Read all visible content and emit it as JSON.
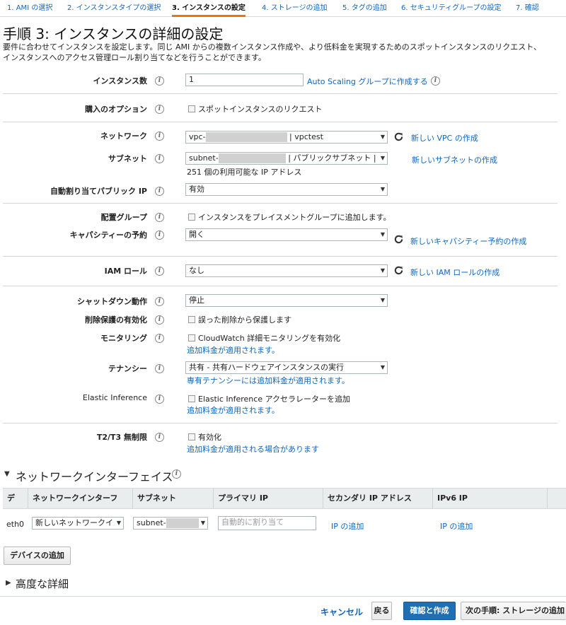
{
  "steps": [
    {
      "label": "1. AMI の選択"
    },
    {
      "label": "2. インスタンスタイプの選択"
    },
    {
      "label": "3. インスタンスの設定"
    },
    {
      "label": "4. ストレージの追加"
    },
    {
      "label": "5. タグの追加"
    },
    {
      "label": "6. セキュリティグループの設定"
    },
    {
      "label": "7. 確認"
    }
  ],
  "title": "手順 3: インスタンスの詳細の設定",
  "description_line1": "要件に合わせてインスタンスを設定します。同じ AMI からの複数インスタンス作成や、より低料金を実現するためのスポットインスタンスのリクエスト、",
  "description_line2": "インスタンスへのアクセス管理ロール割り当てなどを行うことができます。",
  "info_glyph": "i",
  "form": {
    "instance_count": {
      "label": "インスタンス数",
      "value": "1",
      "link": "Auto Scaling グループに作成する"
    },
    "purchase": {
      "label": "購入のオプション",
      "checkbox": "スポットインスタンスのリクエスト"
    },
    "network": {
      "label": "ネットワーク",
      "value_prefix": "vpc-",
      "value_suffix": "| vpctest",
      "link": "新しい VPC の作成"
    },
    "subnet": {
      "label": "サブネット",
      "value_prefix": "subnet-",
      "value_suffix": "| パブリックサブネット |",
      "link": "新しいサブネットの作成",
      "note": "251 個の利用可能な IP アドレス"
    },
    "auto_ip": {
      "label": "自動割り当てパブリック IP",
      "value": "有効"
    },
    "placement": {
      "label": "配置グループ",
      "checkbox": "インスタンスをプレイスメントグループに追加します。"
    },
    "capacity": {
      "label": "キャパシティーの予約",
      "value": "開く",
      "link": "新しいキャパシティー予約の作成"
    },
    "iam": {
      "label": "IAM ロール",
      "value": "なし",
      "link": "新しい IAM ロールの作成"
    },
    "shutdown": {
      "label": "シャットダウン動作",
      "value": "停止"
    },
    "termination": {
      "label": "削除保護の有効化",
      "checkbox": "誤った削除から保護します"
    },
    "monitoring": {
      "label": "モニタリング",
      "checkbox": "CloudWatch 詳細モニタリングを有効化",
      "link": "追加料金が適用されます。"
    },
    "tenancy": {
      "label": "テナンシー",
      "value": "共有 - 共有ハードウェアインスタンスの実行",
      "link": "専有テナンシーには追加料金が適用されます。"
    },
    "elastic": {
      "label": "Elastic Inference",
      "checkbox": "Elastic Inference アクセラレーターを追加",
      "link": "追加料金が適用されます。"
    },
    "t2t3": {
      "label": "T2/T3 無制限",
      "checkbox": "有効化",
      "link": "追加料金が適用される場合があります"
    }
  },
  "network_interfaces": {
    "title": "ネットワークインターフェイス",
    "columns": [
      "デ",
      "ネットワークインターフ",
      "サブネット",
      "プライマリ IP",
      "セカンダリ IP アドレス",
      "IPv6 IP"
    ],
    "row": {
      "device": "eth0",
      "interface": "新しいネットワークイ",
      "subnet_prefix": "subnet-",
      "primary_ip_placeholder": "自動的に割り当て",
      "secondary_link": "IP の追加",
      "ipv6_link": "IP の追加"
    },
    "add_device_button": "デバイスの追加"
  },
  "advanced": {
    "title": "高度な詳細"
  },
  "footer": {
    "cancel": "キャンセル",
    "back": "戻る",
    "review": "確認と作成",
    "next": "次の手順: ストレージの追加"
  }
}
